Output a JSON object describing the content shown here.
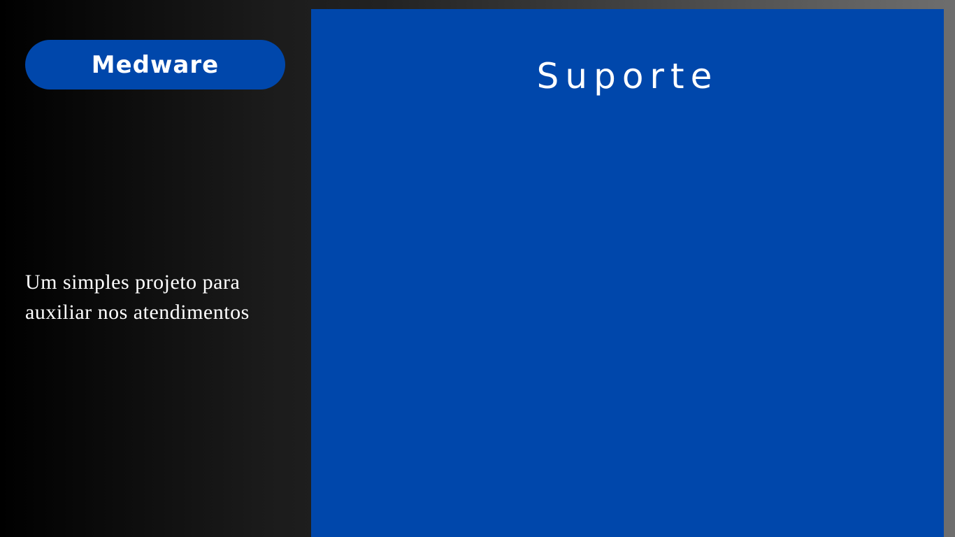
{
  "brand": {
    "label": "Medware"
  },
  "sidebar": {
    "tagline_line1": "Um simples projeto para",
    "tagline_line2": "auxiliar nos atendimentos"
  },
  "main": {
    "title": "Suporte"
  },
  "colors": {
    "accent": "#0047ab",
    "text": "#ffffff",
    "background_dark": "#000000",
    "background_light": "#6e6e6e"
  }
}
